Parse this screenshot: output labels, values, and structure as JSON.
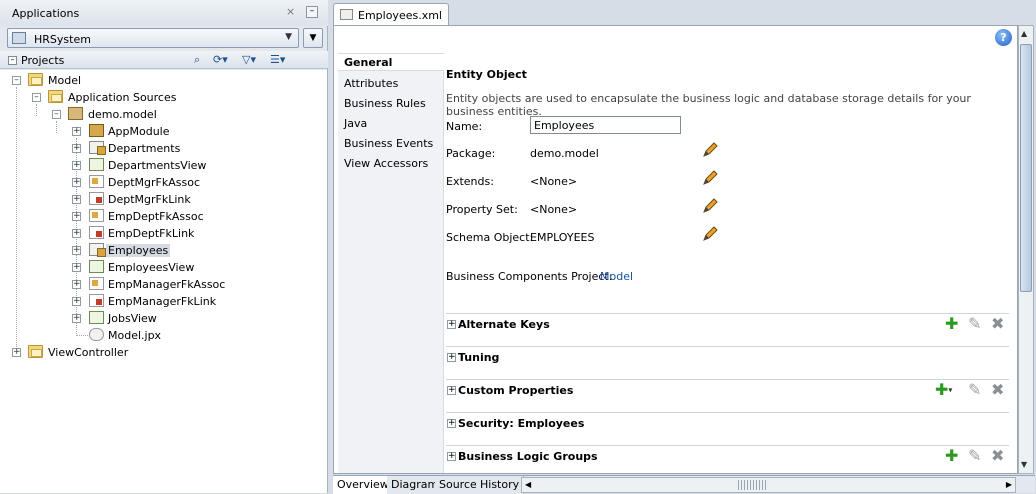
{
  "applications_panel": {
    "title": "Applications",
    "close_glyph": "×",
    "minimize_glyph": "–",
    "selected_application": "HRSystem",
    "projects_label": "Projects"
  },
  "tree": {
    "model": "Model",
    "application_sources": "Application Sources",
    "package": "demo.model",
    "items": [
      {
        "label": "AppModule",
        "icon": "app-module-icon"
      },
      {
        "label": "Departments",
        "icon": "entity-object-icon"
      },
      {
        "label": "DepartmentsView",
        "icon": "view-object-icon"
      },
      {
        "label": "DeptMgrFkAssoc",
        "icon": "association-icon"
      },
      {
        "label": "DeptMgrFkLink",
        "icon": "view-link-icon"
      },
      {
        "label": "EmpDeptFkAssoc",
        "icon": "association-icon"
      },
      {
        "label": "EmpDeptFkLink",
        "icon": "view-link-icon"
      },
      {
        "label": "Employees",
        "icon": "entity-object-icon"
      },
      {
        "label": "EmployeesView",
        "icon": "view-object-icon"
      },
      {
        "label": "EmpManagerFkAssoc",
        "icon": "association-icon"
      },
      {
        "label": "EmpManagerFkLink",
        "icon": "view-link-icon"
      },
      {
        "label": "JobsView",
        "icon": "view-object-icon"
      },
      {
        "label": "Model.jpx",
        "icon": "project-file-icon"
      }
    ],
    "view_controller": "ViewController"
  },
  "editor": {
    "tab_title": "Employees.xml",
    "nav": [
      "General",
      "Attributes",
      "Business Rules",
      "Java",
      "Business Events",
      "View Accessors"
    ],
    "section_title": "Entity Object",
    "description": "Entity objects are used to encapsulate the business logic and database storage details for your business entities.",
    "fields": {
      "name_label": "Name:",
      "name_value": "Employees",
      "package_label": "Package:",
      "package_value": "demo.model",
      "extends_label": "Extends:",
      "extends_value": "<None>",
      "property_set_label": "Property Set:",
      "property_set_value": "<None>",
      "schema_object_label": "Schema Object:",
      "schema_object_value": "EMPLOYEES",
      "bc_project_label": "Business Components Project:",
      "bc_project_value": "Model"
    },
    "sections": [
      "Alternate Keys",
      "Tuning",
      "Custom Properties",
      "Security: Employees",
      "Business Logic Groups"
    ],
    "bottom_tabs": [
      "Overview",
      "Diagram",
      "Source",
      "History"
    ],
    "help_glyph": "?"
  },
  "colors": {
    "link": "#1a4fa0",
    "add_green": "#2a9a1f",
    "accent_panel": "#d6dde6"
  }
}
